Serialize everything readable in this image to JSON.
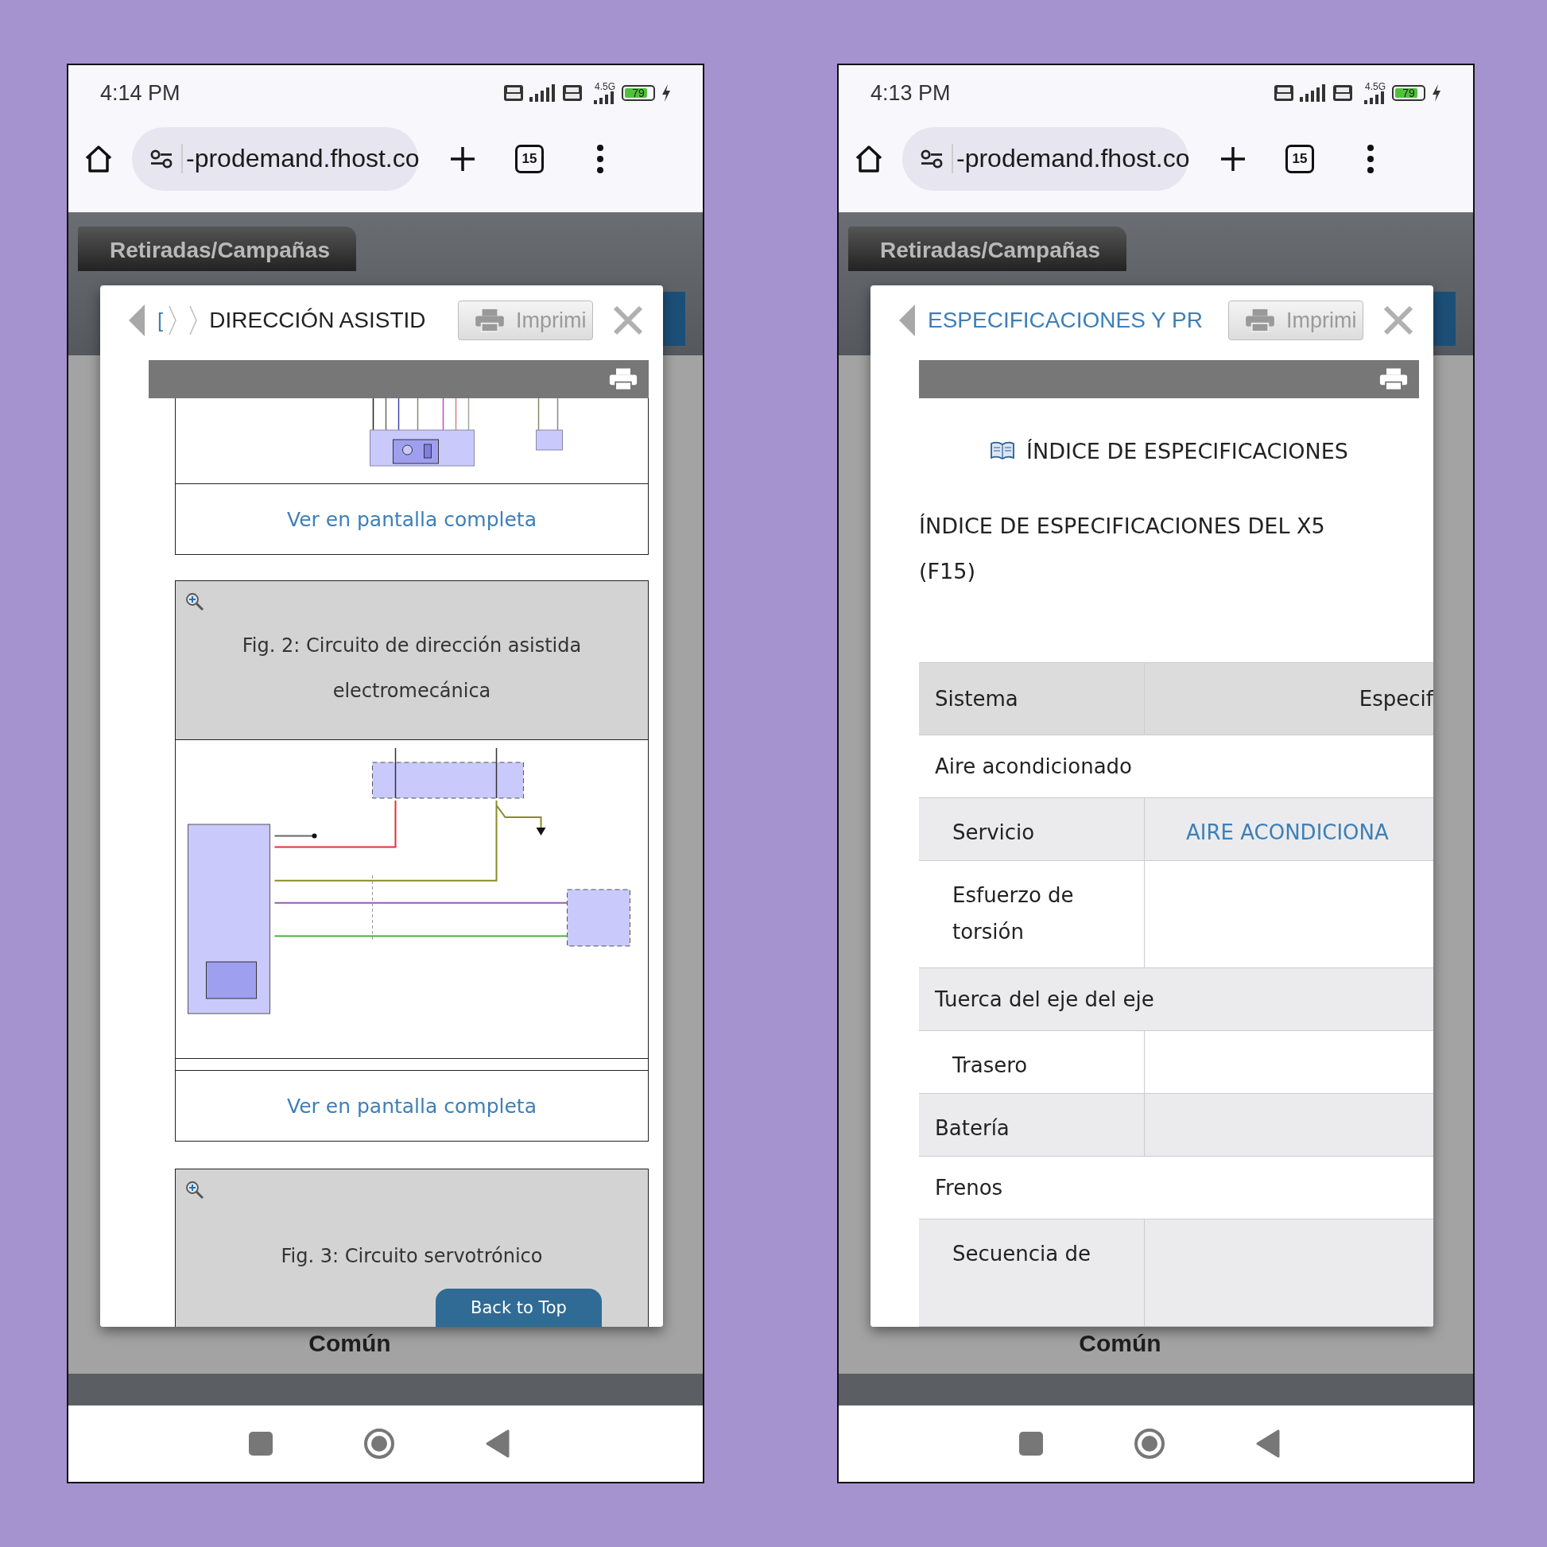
{
  "screens": [
    {
      "kind": "figures",
      "status_bar": {
        "time": "4:14 PM",
        "network": "4.5G",
        "battery": "79"
      },
      "browser": {
        "url": "-prodemand.fhost.co",
        "tab_count": "15"
      },
      "site_tab": "Retiradas/Campañas",
      "footer_label": "Común",
      "modal": {
        "breadcrumb": "[",
        "title": "DIRECCIÓN ASISTID",
        "title_is_link": false,
        "print_button": "Imprimi",
        "figures": [
          {
            "kind": "partial",
            "link": "Ver en pantalla completa"
          },
          {
            "kind": "full",
            "caption": "Fig. 2: Circuito de dirección asistida electromecánica",
            "link": "Ver en pantalla completa"
          },
          {
            "kind": "header_only",
            "caption": "Fig. 3: Circuito servotrónico"
          }
        ],
        "back_to_top": "Back to Top"
      }
    },
    {
      "kind": "spec_index",
      "status_bar": {
        "time": "4:13 PM",
        "network": "4.5G",
        "battery": "79"
      },
      "browser": {
        "url": "-prodemand.fhost.co",
        "tab_count": "15"
      },
      "site_tab": "Retiradas/Campañas",
      "footer_label": "Común",
      "modal": {
        "title": "ESPECIFICACIONES Y PR",
        "title_is_link": true,
        "print_button": "Imprimi",
        "index_title": "ÍNDICE DE ESPECIFICACIONES",
        "heading": "ÍNDICE DE ESPECIFICACIONES DEL X5 (F15)",
        "table": {
          "columns": [
            "Sistema",
            "Especif"
          ],
          "rows": [
            {
              "kind": "group",
              "label": "Aire acondicionado"
            },
            {
              "kind": "item",
              "label": "Servicio",
              "value": "AIRE ACONDICIONA"
            },
            {
              "kind": "item",
              "label": "Esfuerzo de torsión"
            },
            {
              "kind": "group",
              "label": "Tuerca del eje del eje"
            },
            {
              "kind": "item",
              "label": "Trasero"
            },
            {
              "kind": "split",
              "label": "Batería"
            },
            {
              "kind": "group",
              "label": "Frenos"
            },
            {
              "kind": "item",
              "label": "Secuencia de"
            }
          ]
        }
      }
    }
  ]
}
